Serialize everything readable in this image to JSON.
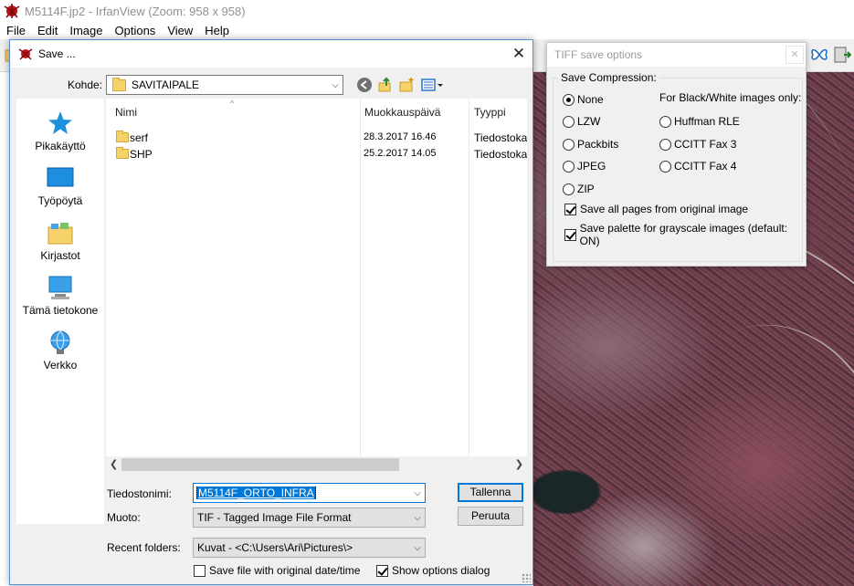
{
  "app": {
    "title": "M5114F.jp2 - IrfanView (Zoom: 958 x 958)",
    "menu": [
      "File",
      "Edit",
      "Image",
      "Options",
      "View",
      "Help"
    ]
  },
  "save_dialog": {
    "title": "Save ...",
    "look_in_label": "Kohde:",
    "look_in_value": "SAVITAIPALE",
    "places": [
      {
        "label": "Pikakäyttö",
        "icon": "star-icon"
      },
      {
        "label": "Työpöytä",
        "icon": "desktop-icon"
      },
      {
        "label": "Kirjastot",
        "icon": "libraries-icon"
      },
      {
        "label": "Tämä tietokone",
        "icon": "computer-icon"
      },
      {
        "label": "Verkko",
        "icon": "network-icon"
      }
    ],
    "columns": {
      "name": "Nimi",
      "modified": "Muokkauspäivä",
      "type": "Tyyppi"
    },
    "files": [
      {
        "name": "serf",
        "modified": "28.3.2017 16.46",
        "type": "Tiedostokansio"
      },
      {
        "name": "SHP",
        "modified": "25.2.2017 14.05",
        "type": "Tiedostokansio"
      }
    ],
    "filename_label": "Tiedostonimi:",
    "filename_value": "M5114F_ORTO_INFRA",
    "format_label": "Muoto:",
    "format_value": "TIF - Tagged Image File Format",
    "recent_label": "Recent folders:",
    "recent_value": "Kuvat  -  <C:\\Users\\Ari\\Pictures\\>",
    "save_button": "Tallenna",
    "cancel_button": "Peruuta",
    "keep_date_label": "Save file with original date/time",
    "keep_date_checked": false,
    "show_options_label": "Show options dialog",
    "show_options_checked": true
  },
  "tiff_dialog": {
    "title": "TIFF save options",
    "group_label": "Save Compression:",
    "bw_label": "For Black/White images only:",
    "options_left": [
      {
        "label": "None",
        "selected": true
      },
      {
        "label": "LZW",
        "selected": false
      },
      {
        "label": "Packbits",
        "selected": false
      },
      {
        "label": "JPEG",
        "selected": false
      },
      {
        "label": "ZIP",
        "selected": false
      }
    ],
    "options_right": [
      {
        "label": "Huffman RLE",
        "selected": false
      },
      {
        "label": "CCITT Fax 3",
        "selected": false
      },
      {
        "label": "CCITT Fax 4",
        "selected": false
      }
    ],
    "save_all_pages_label": "Save all pages from original image",
    "save_all_pages_checked": true,
    "save_palette_label": "Save palette for grayscale images (default: ON)",
    "save_palette_checked": true
  },
  "colors": {
    "accent": "#0078d7",
    "dialog_bg": "#f0f0f0",
    "folder": "#f5d36a"
  }
}
